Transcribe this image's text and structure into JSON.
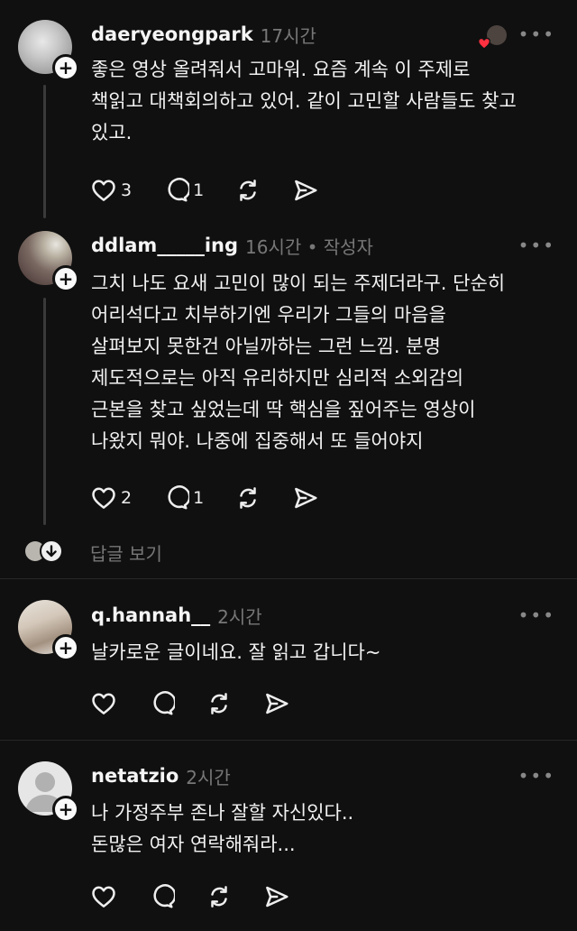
{
  "comments": [
    {
      "username": "daeryeongpark",
      "time": "17시간",
      "text": "좋은 영상 올려줘서 고마워. 요즘 계속 이 주제로\n책읽고 대책회의하고 있어. 같이 고민할 사람들도 찾고\n있고.",
      "likes": "3",
      "replies": "1"
    },
    {
      "username": "ddlam_____ing",
      "time": "16시간 • 작성자",
      "text": "그치 나도 요새 고민이 많이 되는 주제더라구. 단순히\n어리석다고 치부하기엔 우리가 그들의 마음을\n살펴보지 못한건 아닐까하는 그런 느낌. 분명\n제도적으로는 아직 유리하지만 심리적 소외감의\n근본을 찾고 싶었는데 딱 핵심을 짚어주는 영상이\n나왔지 뭐야. 나중에 집중해서 또 들어야지",
      "likes": "2",
      "replies": "1"
    },
    {
      "username": "q.hannah__",
      "time": "2시간",
      "text": "날카로운 글이네요. 잘 읽고 갑니다~"
    },
    {
      "username": "netatzio",
      "time": "2시간",
      "text": "나 가정주부 존나 잘할 자신있다..\n돈많은 여자 연락해줘라..."
    }
  ],
  "view_replies_label": "답글 보기",
  "more_label": "•••",
  "follow_symbol": "+",
  "icons": [
    "heart-icon",
    "comment-icon",
    "repost-icon",
    "share-icon",
    "arrow-down-icon",
    "profile-placeholder-icon"
  ]
}
